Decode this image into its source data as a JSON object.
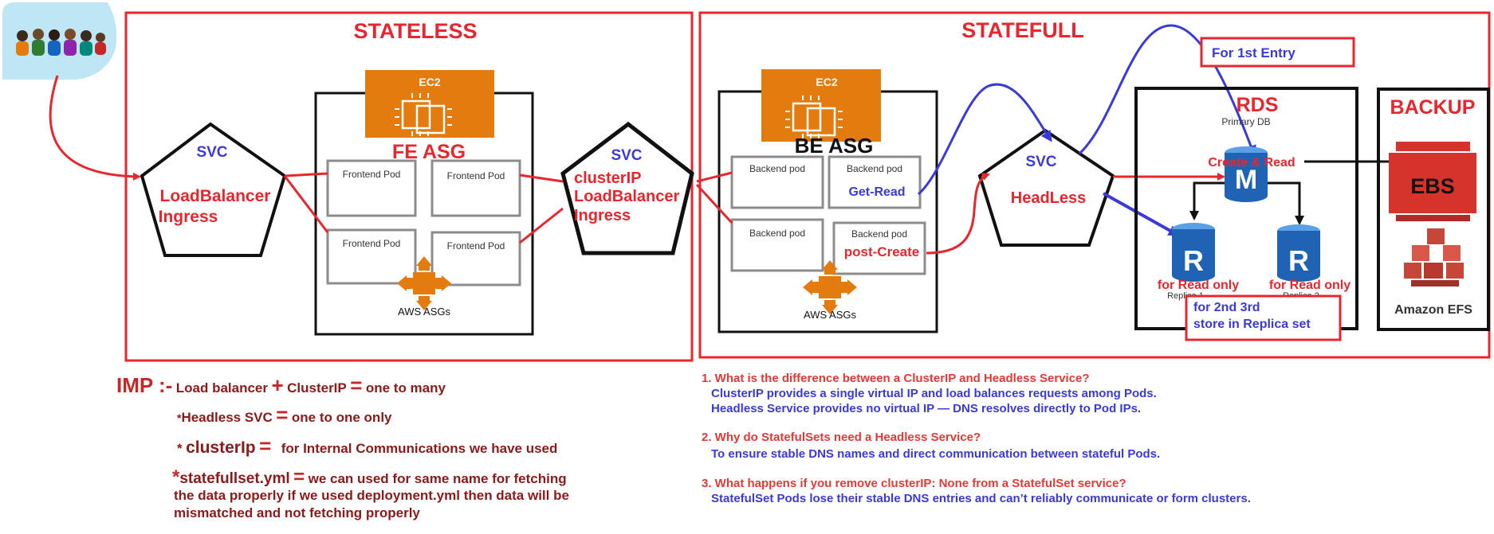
{
  "colors": {
    "red": "#e8262e",
    "blue": "#3a3ad8",
    "orange": "#e37b0f",
    "black": "#111111",
    "gray": "#8c8c8c",
    "db_blue": "#1f63b5",
    "ebs_red": "#d6332b",
    "efs_red": "#c4473a",
    "avatar_bg": "#bfe6f5"
  },
  "icons": [
    "people-group-icon",
    "ec2-chip-icon",
    "asg-arrows-icon",
    "rds-database-icon",
    "ebs-volume-icon",
    "efs-cubes-icon"
  ],
  "stateless": {
    "title": "STATELESS",
    "svc_label": "SVC",
    "svc_type_1": "LoadBalancer",
    "svc_type_2": "Ingress",
    "ec2_label": "EC2",
    "asg_title": "FE ASG",
    "pods": [
      "Frontend Pod",
      "Frontend Pod",
      "Frontend Pod",
      "Frontend Pod"
    ],
    "asg_caption": "AWS ASGs",
    "svc2_label": "SVC",
    "svc2_type_1": "clusterIP",
    "svc2_type_2": "LoadBalancer",
    "svc2_type_3": "Ingress"
  },
  "stateful": {
    "title": "STATEFULL",
    "ec2_label": "EC2",
    "asg_title": "BE ASG",
    "pods": [
      "Backend pod",
      "Backend pod",
      "Backend pod",
      "Backend pod"
    ],
    "get_label": "Get-Read",
    "post_label": "post-Create",
    "asg_caption": "AWS ASGs",
    "svc_label": "SVC",
    "svc_type": "HeadLess",
    "first_entry": "For 1st Entry",
    "rds_title": "RDS",
    "primary_db": "Primary DB",
    "create_read": "Create & Read",
    "m_letter": "M",
    "r_letter": "R",
    "replica_1": "Replica 1",
    "replica_2": "Replica 2",
    "read_only_1": "for Read only",
    "read_only_2": "for Read only",
    "replica_note_1": "for 2nd 3rd",
    "replica_note_2": "store in Replica set",
    "backup_title": "BACKUP",
    "ebs_label": "EBS",
    "efs_label": "Amazon EFS"
  },
  "imp": {
    "title": "IMP :-",
    "line1_a": "Load balancer",
    "line1_plus": "+",
    "line1_b": "ClusterIP",
    "line1_eq": "=",
    "line1_c": "one to many",
    "line2_star": "*",
    "line2_a": "Headless SVC",
    "line2_eq": "=",
    "line2_b": "one to one only",
    "line3_star": "*",
    "line3_a": "clusterIp",
    "line3_eq": "=",
    "line3_b": "for Internal Communications we have used",
    "line4_star": "*",
    "line4_a": "statefullset.yml",
    "line4_eq": "=",
    "line4_b": "we can used for same name for fetching",
    "line5": "the data properly if we used deployment.yml then data will be",
    "line6": "mismatched and not fetching properly"
  },
  "qa": [
    {
      "q": "1. What is the difference between a ClusterIP and Headless Service?",
      "a": [
        "ClusterIP provides a single virtual IP and load balances requests among Pods.",
        "Headless Service provides no virtual IP — DNS resolves directly to Pod IPs."
      ]
    },
    {
      "q": "2. Why do StatefulSets need a Headless Service?",
      "a": [
        "To ensure stable DNS names and direct communication between stateful Pods."
      ]
    },
    {
      "q": "3. What happens if you remove clusterIP: None from a StatefulSet service?",
      "a": [
        "StatefulSet Pods lose their stable DNS entries and can’t reliably communicate or form clusters."
      ]
    }
  ]
}
